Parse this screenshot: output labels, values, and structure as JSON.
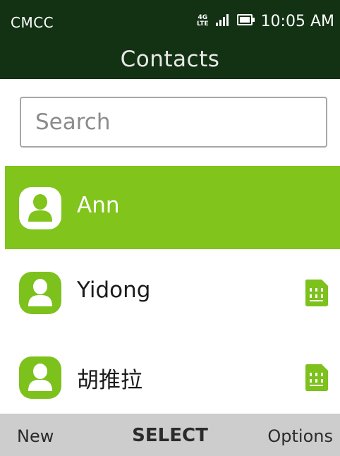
{
  "status": {
    "carrier": "CMCC",
    "network_top": "4G",
    "network_bottom": "LTE",
    "time": "10:05 AM"
  },
  "header": {
    "title": "Contacts"
  },
  "search": {
    "placeholder": "Search"
  },
  "contacts": [
    {
      "name": "Ann",
      "selected": true,
      "sim": false
    },
    {
      "name": "Yidong",
      "selected": false,
      "sim": true
    },
    {
      "name": "胡推拉",
      "selected": false,
      "sim": true
    }
  ],
  "softkeys": {
    "left": "New",
    "center": "SELECT",
    "right": "Options"
  },
  "colors": {
    "header_bg": "#133113",
    "accent": "#80c41c",
    "softkey_bg": "#cdcdcd"
  },
  "icons": {
    "signal": "signal-bars-icon",
    "battery": "battery-icon",
    "avatar": "person-icon",
    "sim": "sim-card-icon"
  }
}
